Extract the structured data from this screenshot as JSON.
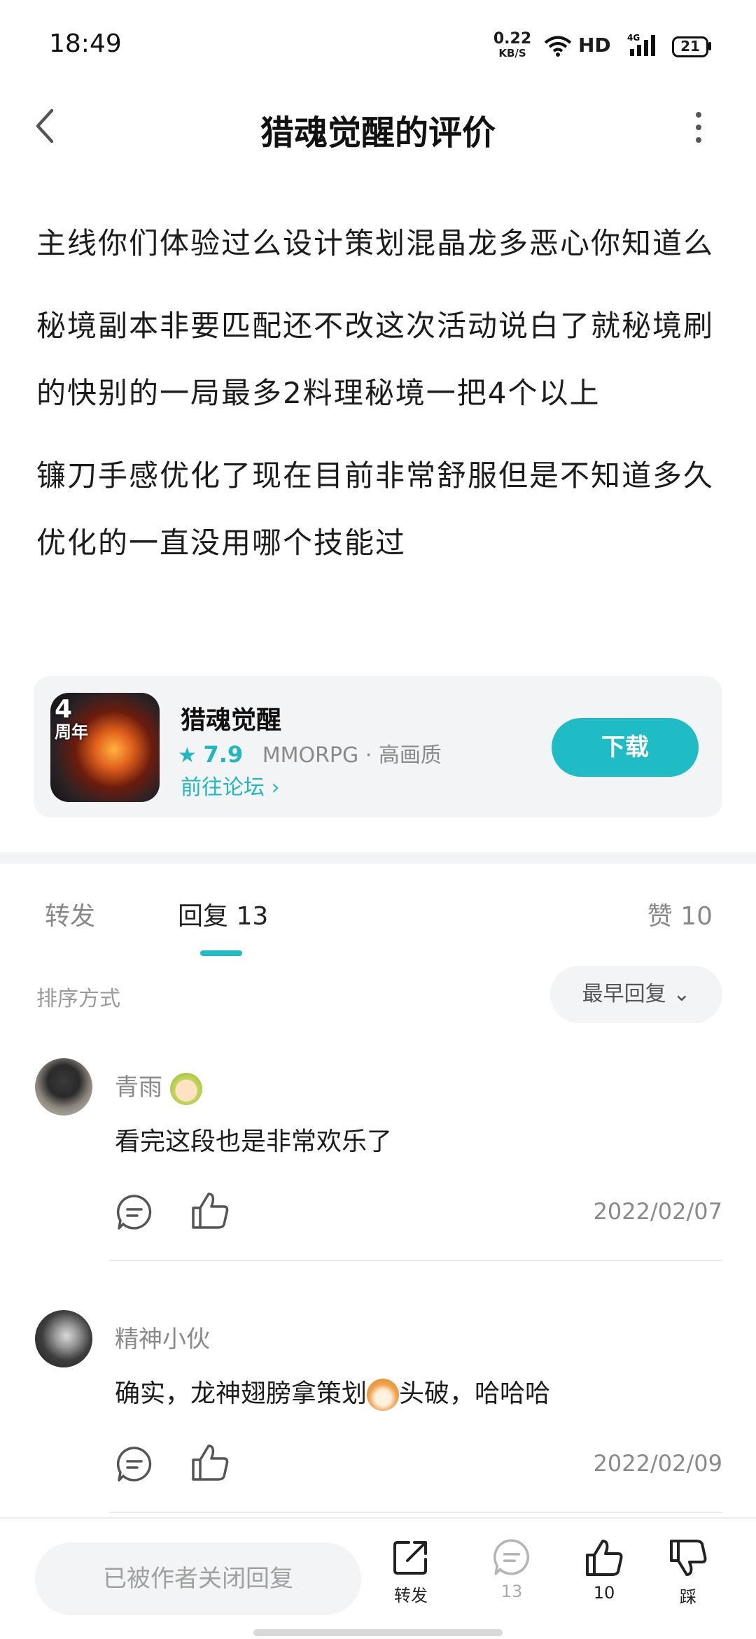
{
  "status_bar": {
    "time": "18:49",
    "net_speed_value": "0.22",
    "net_speed_unit": "KB/S",
    "hd_label": "HD",
    "signal_label": "4G",
    "battery": "21"
  },
  "header": {
    "title": "猎魂觉醒的评价"
  },
  "review": {
    "paragraphs": [
      "主线你们体验过么设计策划混晶龙多恶心你知道么",
      "秘境副本非要匹配还不改这次活动说白了就秘境刷的快别的一局最多2料理秘境一把4个以上",
      "镰刀手感优化了现在目前非常舒服但是不知道多久优化的一直没用哪个技能过"
    ]
  },
  "game_card": {
    "logo_text_big": "4",
    "logo_text_small": "周年",
    "name": "猎魂觉醒",
    "rating": "7.9",
    "meta": "MMORPG · 高画质",
    "forum_link": "前往论坛",
    "download_label": "下载"
  },
  "tabs": {
    "forward": "转发",
    "reply": "回复",
    "reply_count": "13",
    "like": "赞",
    "like_count": "10"
  },
  "sort": {
    "label": "排序方式",
    "selected": "最早回复"
  },
  "replies": [
    {
      "author": "青雨",
      "text": "看完这段也是非常欢乐了",
      "date": "2022/02/07"
    },
    {
      "author": "精神小伙",
      "text_before": "确实，龙神翅膀拿策划",
      "text_after": "头破，哈哈哈",
      "date": "2022/02/09"
    }
  ],
  "bottom_bar": {
    "input_placeholder": "已被作者关闭回复",
    "forward_label": "转发",
    "comment_count": "13",
    "like_count": "10",
    "dislike_label": "踩"
  },
  "colors": {
    "accent": "#20bcc5"
  }
}
